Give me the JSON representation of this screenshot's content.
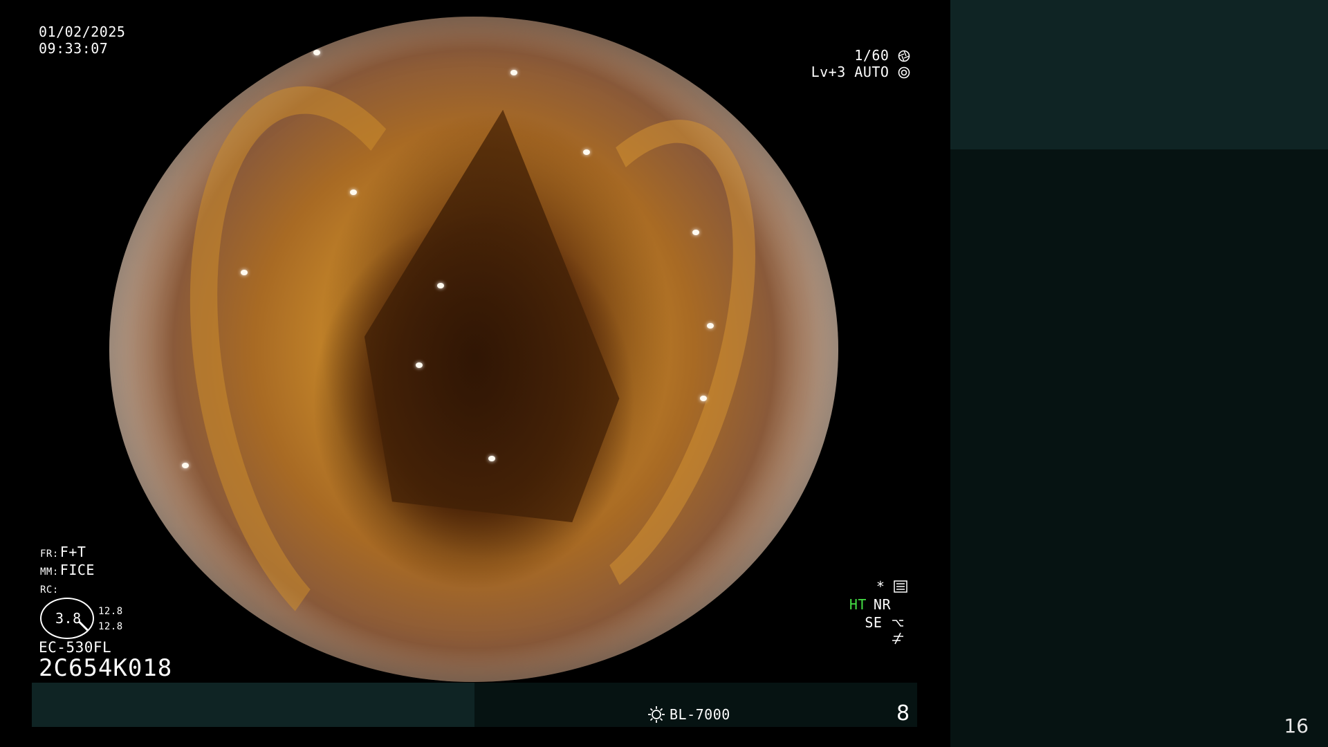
{
  "overlay": {
    "date": "01/02/2025",
    "time": "09:33:07",
    "shutter": "1/60",
    "level_mode": "Lv+3 AUTO",
    "fr_label": "FR:",
    "fr_value": "F+T",
    "mm_label": "MM:",
    "mm_value": "FICE",
    "rc_label": "RC:",
    "rc_gauge_value": "3.8",
    "rc_top": "12.8",
    "rc_bottom": "12.8",
    "scope_model": "EC-530FL",
    "scope_serial": "2C654K018",
    "settings_star": "*",
    "ht": "HT",
    "nr": "NR",
    "se": "SE"
  },
  "bottom_bar": {
    "light_source": "BL-7000",
    "number": "8"
  },
  "side_panel": {
    "page_number": "16"
  },
  "icons": {
    "shutter": "aperture-icon",
    "auto": "iris-icon",
    "settings": "menu-icon",
    "se": "enhance-icon",
    "filter": "filter-icon",
    "light": "sun-icon"
  },
  "colors": {
    "background": "#000000",
    "panel_dark": "#061312",
    "panel_teal": "#0f2424",
    "ht_green": "#44dd44"
  }
}
